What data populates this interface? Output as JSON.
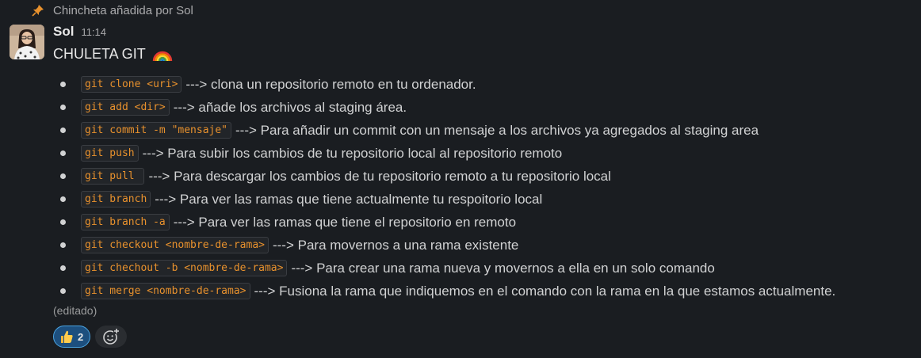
{
  "pinned": {
    "text": "Chincheta añadida por Sol",
    "icon": "pin-icon"
  },
  "message": {
    "author": "Sol",
    "time": "11:14",
    "title": "CHULETA GIT",
    "title_emoji": "rainbow-icon",
    "items": [
      {
        "code": "git clone <uri>",
        "text": "---> clona un repositorio remoto en tu ordenador."
      },
      {
        "code": "git add <dir>",
        "text": "---> añade los archivos al staging área."
      },
      {
        "code": "git commit -m \"mensaje\"",
        "text": "---> Para añadir un commit con un mensaje a los archivos ya agregados al staging area"
      },
      {
        "code": "git push",
        "text": "---> Para subir los cambios de tu repositorio local al repositorio remoto"
      },
      {
        "code": "git pull ",
        "text": "---> Para descargar los cambios de tu repositorio remoto a tu repositorio local"
      },
      {
        "code": "git branch",
        "text": "---> Para ver las ramas que tiene actualmente tu respoitorio local"
      },
      {
        "code": "git branch -a",
        "text": "---> Para ver las ramas que tiene el repositorio en remoto"
      },
      {
        "code": "git checkout <nombre-de-rama>",
        "text": "---> Para movernos a una rama existente"
      },
      {
        "code": "git chechout -b <nombre-de-rama>",
        "text": "---> Para crear una rama nueva y movernos a ella en un solo comando"
      },
      {
        "code": "git merge <nombre-de-rama>",
        "text": "---> Fusiona la rama que indiquemos en el comando con la rama en la que estamos actualmente."
      }
    ],
    "edited": "(editado)",
    "reactions": [
      {
        "icon": "thumbs-up-icon",
        "count": "2"
      }
    ],
    "add_reaction_icon": "add-reaction-icon"
  },
  "colors": {
    "background": "#1a1d21",
    "code_text": "#e8912d",
    "reaction_bg": "#1d4f7e",
    "reaction_border": "#4aa3e0"
  }
}
